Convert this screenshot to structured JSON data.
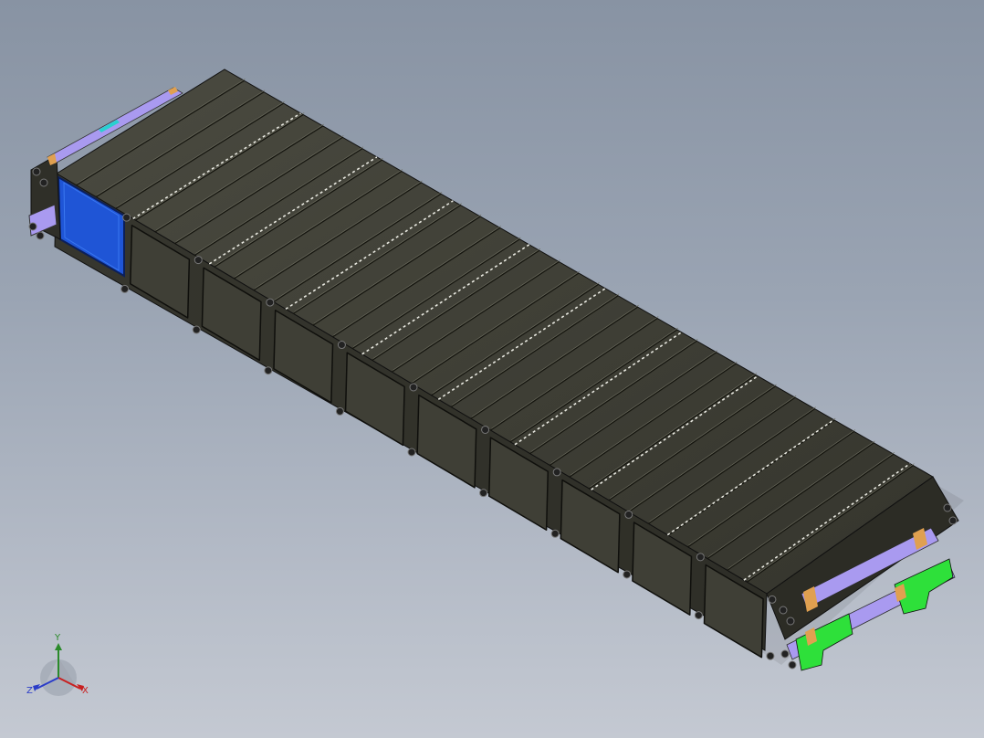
{
  "viewport": {
    "background_top": "#8893a3",
    "background_bottom": "#c4c9d2"
  },
  "model": {
    "description_icon": "battery-module-assembly-3d-model",
    "module_frame_color": "#3a3a32",
    "cell_face_color": "#3f3f36",
    "highlighted_face_color": "#1f55d6",
    "busbar_color": "#a99af0",
    "terminal_color": "#2ee03a",
    "tab_color": "#e0a050",
    "cell_window_count": 9,
    "fin_count": 36
  },
  "triad": {
    "x_label": "X",
    "y_label": "Y",
    "z_label": "Z",
    "x_color": "#c82020",
    "y_color": "#2a8a2a",
    "z_color": "#2a3cc8"
  }
}
